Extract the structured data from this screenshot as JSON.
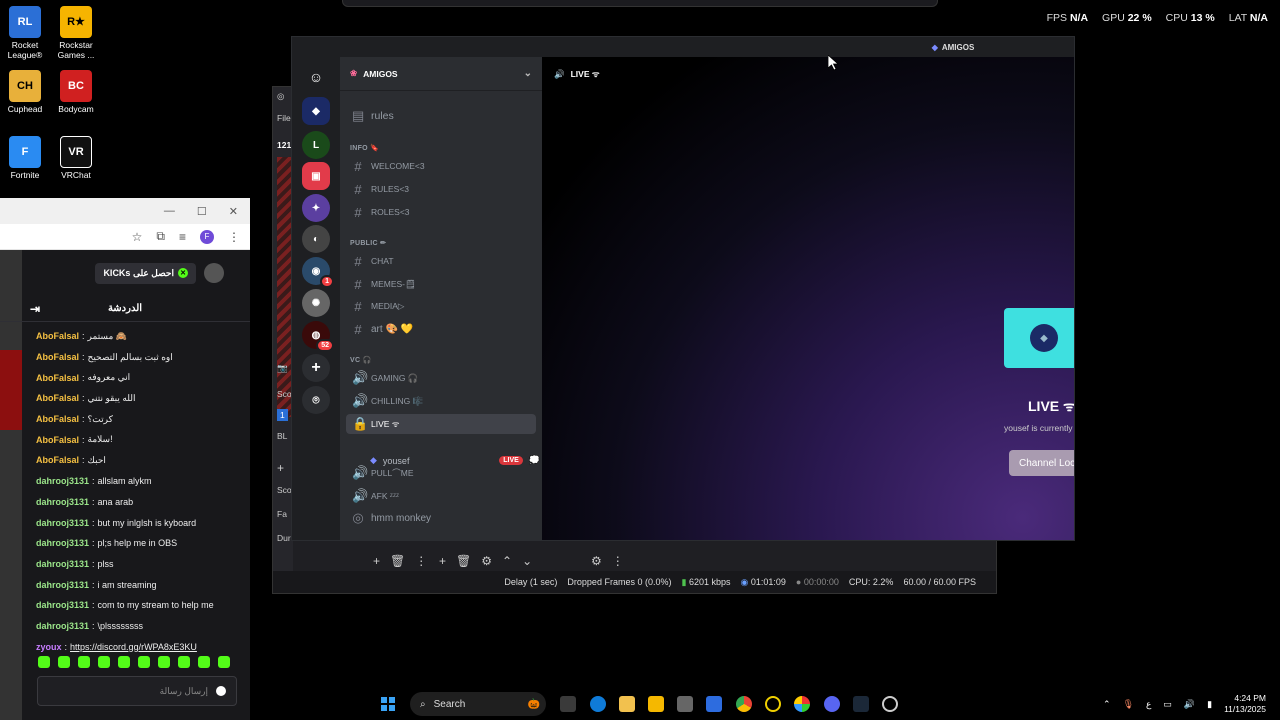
{
  "desktop": {
    "icons": [
      {
        "label": "Rocket League®",
        "name": "rocket-league-icon",
        "color": "#2b6fd6"
      },
      {
        "label": "Rockstar Games ...",
        "name": "rockstar-icon",
        "color": "#f6b400"
      },
      {
        "label": "Cuphead",
        "name": "cuphead-icon",
        "color": "#e8b03a"
      },
      {
        "label": "Bodycam",
        "name": "bodycam-icon",
        "color": "#d02020"
      },
      {
        "label": "Fortnite",
        "name": "fortnite-icon",
        "color": "#2a8bf2"
      },
      {
        "label": "VRChat",
        "name": "vrchat-icon",
        "color": "#111111"
      }
    ]
  },
  "stats": [
    {
      "key": "FPS",
      "value": "N/A"
    },
    {
      "key": "GPU",
      "value": "22 %"
    },
    {
      "key": "CPU",
      "value": "13 %"
    },
    {
      "key": "LAT",
      "value": "N/A"
    }
  ],
  "obs": {
    "menu_file": "File",
    "num": "121",
    "sc1": "Sco",
    "sc2": "Sco",
    "sc3": "Sco",
    "bl": "BL",
    "fa": "Fa",
    "dur": "Dura",
    "status": {
      "delay": "Delay (1 sec)",
      "dropped": "Dropped Frames 0 (0.0%)",
      "kbps": "6201 kbps",
      "rec_time": "01:01:09",
      "stream_time": "00:00:00",
      "cpu": "CPU: 2.2%",
      "fps": "60.00 / 60.00 FPS"
    }
  },
  "discord": {
    "title": "AMIGOS",
    "server_name": "AMIGOS",
    "guild_badges": [
      "1",
      "52"
    ],
    "channel_rules": "rules",
    "categories": {
      "info": "INFO 🔖",
      "public": "PUBLIC ✏",
      "vc": "VC 🎧"
    },
    "channels": {
      "welcome": "WELCOME<3",
      "rules": "RULES<3",
      "roles": "ROLES<3",
      "chat": "CHAT",
      "memes": "MEMES-🗒",
      "media": "MEDIA▷",
      "art": "art 🎨 💛",
      "gaming": "GAMING 🎧",
      "chilling": "CHILLING 🎼",
      "live": "LIVE ᯤ",
      "pull": "PULL⌒ME",
      "afk": "AFK ᶻᶻᶻ",
      "monkey": "hmm monkey"
    },
    "member": {
      "name": "yousef",
      "badge": "LIVE"
    },
    "main_header": "LIVE ᯤ",
    "live_title": "LIVE ᯤ",
    "live_sub": "yousef is currently",
    "channel_button": "Channel Loc"
  },
  "browser": {
    "profile": "F",
    "kick_button": "KICKs احصل على",
    "chat_title": "الدردشة",
    "messages": [
      {
        "user": "AboFalsal",
        "text": "مستمر 🙈",
        "color": "#f5c042"
      },
      {
        "user": "AboFalsal",
        "text": "اوه ثبت بسالم التصحيح",
        "color": "#f5c042"
      },
      {
        "user": "AboFalsal",
        "text": "اني معروفه",
        "color": "#f5c042"
      },
      {
        "user": "AboFalsal",
        "text": "الله يبقو نتني",
        "color": "#f5c042"
      },
      {
        "user": "AboFalsal",
        "text": "كرتت؟",
        "color": "#f5c042"
      },
      {
        "user": "AboFalsal",
        "text": "سلامة!",
        "color": "#f5c042"
      },
      {
        "user": "AboFalsal",
        "text": "احبك",
        "color": "#f5c042"
      },
      {
        "user": "dahrooj3131",
        "text": "allslam alykm",
        "color": "#9be58a"
      },
      {
        "user": "dahrooj3131",
        "text": "ana arab",
        "color": "#9be58a"
      },
      {
        "user": "dahrooj3131",
        "text": "but my inlglsh is kyboard",
        "color": "#9be58a"
      },
      {
        "user": "dahrooj3131",
        "text": "pl;s help me in OBS",
        "color": "#9be58a"
      },
      {
        "user": "dahrooj3131",
        "text": "plss",
        "color": "#9be58a"
      },
      {
        "user": "dahrooj3131",
        "text": "i am streaming",
        "color": "#9be58a"
      },
      {
        "user": "dahrooj3131",
        "text": "com to my stream to help me",
        "color": "#9be58a"
      },
      {
        "user": "dahrooj3131",
        "text": "\\plssssssss",
        "color": "#9be58a"
      },
      {
        "user": "zyoux",
        "text": "https://discord.gg/rWPA8xE3KU",
        "color": "#c77dff"
      }
    ],
    "input_placeholder": "إرسال رسالة"
  },
  "taskbar": {
    "search": "Search",
    "time": "4:24 PM",
    "date": "11/13/2025",
    "lang": "ع"
  }
}
